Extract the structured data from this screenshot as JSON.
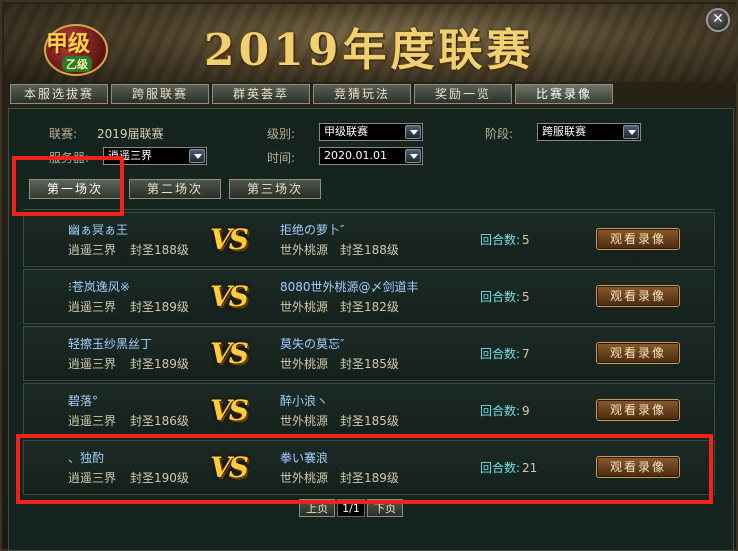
{
  "banner": {
    "logo_text": "甲级",
    "logo_sub": "乙级",
    "title": "2019年度联赛",
    "close": "✕"
  },
  "tabs": [
    {
      "label": "本服选拔赛",
      "active": false
    },
    {
      "label": "跨服联赛",
      "active": false
    },
    {
      "label": "群英荟萃",
      "active": false
    },
    {
      "label": "竞猜玩法",
      "active": false
    },
    {
      "label": "奖励一览",
      "active": false
    },
    {
      "label": "比赛录像",
      "active": true
    }
  ],
  "filters": {
    "league_label": "联赛:",
    "league_value": "2019届联赛",
    "level_label": "级别:",
    "level_value": "甲级联赛",
    "stage_label": "阶段:",
    "stage_value": "跨服联赛",
    "server_label": "服务器:",
    "server_value": "逍遥三界",
    "time_label": "时间:",
    "time_value": "2020.01.01"
  },
  "subtabs": [
    {
      "label": "第一场次",
      "active": true
    },
    {
      "label": "第二场次",
      "active": false
    },
    {
      "label": "第三场次",
      "active": false
    }
  ],
  "vs_text": "VS",
  "rounds_label": "回合数:",
  "watch_label": "观看录像",
  "matches": [
    {
      "p1_name": "幽ぁ冥ぁ王",
      "p1_server": "逍遥三界",
      "p1_level": "封圣188级",
      "p2_name": "拒绝の萝卜″",
      "p2_server": "世外桃源",
      "p2_level": "封圣188级",
      "rounds": "5"
    },
    {
      "p1_name": "⁝苍岚逸风※",
      "p1_server": "逍遥三界",
      "p1_level": "封圣189级",
      "p2_name": "8080世外桃源@〆剑道丰",
      "p2_server": "世外桃源",
      "p2_level": "封圣182级",
      "rounds": "5"
    },
    {
      "p1_name": "轻擦玉纱黑丝丁",
      "p1_server": "逍遥三界",
      "p1_level": "封圣189级",
      "p2_name": "莫失の莫忘″",
      "p2_server": "世外桃源",
      "p2_level": "封圣185级",
      "rounds": "7"
    },
    {
      "p1_name": "碧落°",
      "p1_server": "逍遥三界",
      "p1_level": "封圣186级",
      "p2_name": "醉小浪ヽ",
      "p2_server": "世外桃源",
      "p2_level": "封圣185级",
      "rounds": "9"
    },
    {
      "p1_name": "、独酌",
      "p1_server": "逍遥三界",
      "p1_level": "封圣190级",
      "p2_name": "拳い褰浪",
      "p2_server": "世外桃源",
      "p2_level": "封圣189级",
      "rounds": "21"
    }
  ],
  "pager": {
    "prev": "上页",
    "page": "1/1",
    "next": "下页"
  },
  "colors": {
    "highlight": "#f0221a",
    "vs": "#ffcc40",
    "player_name": "#9fd0ff",
    "rounds_label": "#6ee0e8"
  }
}
